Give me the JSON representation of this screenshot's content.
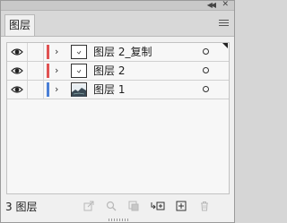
{
  "header": {
    "collapse_icon": "double-chevron-left-icon",
    "close_icon": "close-icon",
    "tab_label": "图层",
    "menu_icon": "hamburger-menu-icon"
  },
  "layers": [
    {
      "name": "图层 2_复制",
      "color": "#e05252",
      "thumb": "blank-with-mark",
      "has_corner": true
    },
    {
      "name": "图层 2",
      "color": "#e05252",
      "thumb": "blank-with-mark",
      "has_corner": false
    },
    {
      "name": "图层 1",
      "color": "#4a7fd6",
      "thumb": "image",
      "has_corner": false
    }
  ],
  "footer": {
    "count_label": "3 图层",
    "icons": [
      "export-icon",
      "search-icon",
      "clipping-mask-icon",
      "new-sublayer-icon",
      "new-layer-icon",
      "delete-icon"
    ]
  }
}
